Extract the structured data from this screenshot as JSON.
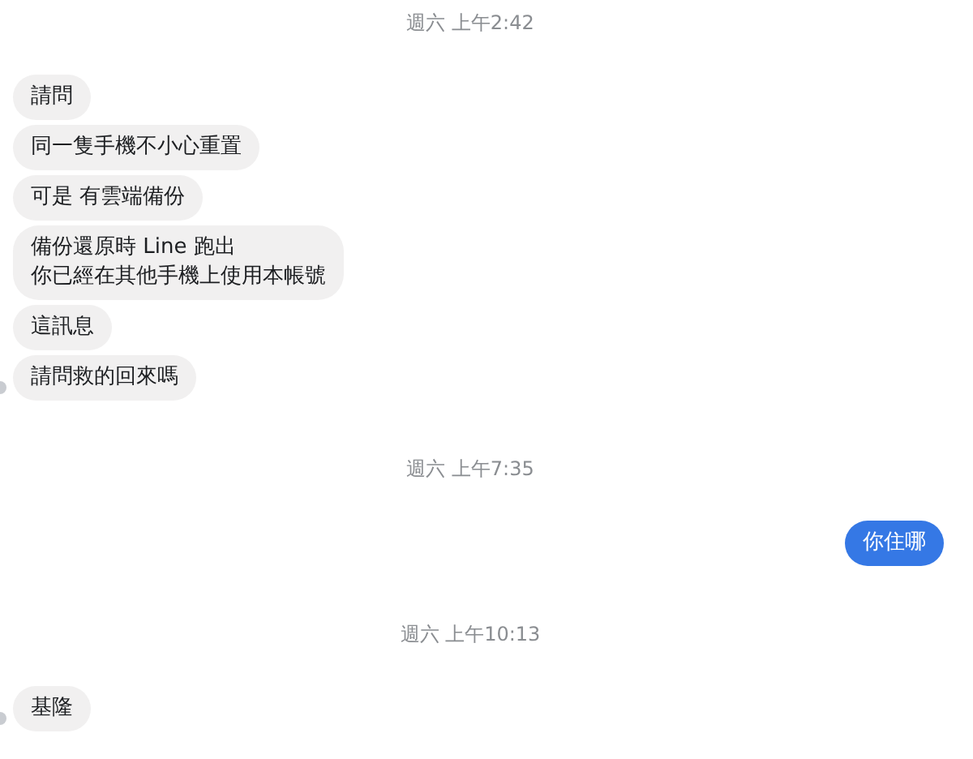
{
  "sections": [
    {
      "time": "週六 上午2:42",
      "messages": [
        {
          "kind": "incoming",
          "lines": [
            "請問"
          ],
          "avatar": false
        },
        {
          "kind": "incoming",
          "lines": [
            "同一隻手機不小心重置"
          ],
          "avatar": false
        },
        {
          "kind": "incoming",
          "lines": [
            "可是 有雲端備份"
          ],
          "avatar": false
        },
        {
          "kind": "incoming",
          "lines": [
            "備份還原時 Line 跑出",
            "你已經在其他手機上使用本帳號"
          ],
          "avatar": false
        },
        {
          "kind": "incoming",
          "lines": [
            "這訊息"
          ],
          "avatar": false
        },
        {
          "kind": "incoming",
          "lines": [
            "請問救的回來嗎"
          ],
          "avatar": true
        }
      ]
    },
    {
      "time": "週六 上午7:35",
      "messages": [
        {
          "kind": "outgoing",
          "lines": [
            "你住哪"
          ],
          "avatar": false
        }
      ]
    },
    {
      "time": "週六 上午10:13",
      "messages": [
        {
          "kind": "incoming",
          "lines": [
            "基隆"
          ],
          "avatar": true
        }
      ]
    }
  ]
}
